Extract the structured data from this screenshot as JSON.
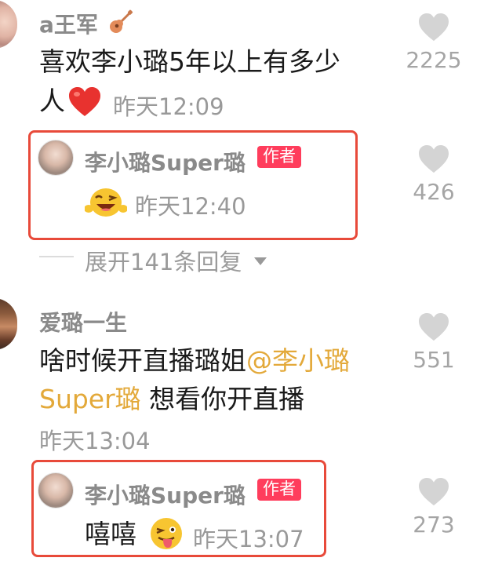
{
  "comments": [
    {
      "username": "a王军",
      "username_icon": "guitar-icon",
      "text_line1": "喜欢李小璐5年以上有多少",
      "text_line2": "人",
      "text_emoji": "red-heart-icon",
      "time": "昨天12:09",
      "likes": "2225",
      "reply": {
        "username": "李小璐Super璐",
        "badge": "作者",
        "emoji": "laughing-winking-emoji",
        "time": "昨天12:40",
        "likes": "426"
      },
      "expand_label": "展开141条回复"
    },
    {
      "username": "爱璐一生",
      "text_line1": "啥时候开直播璐姐",
      "mention_line1": "@李小璐",
      "mention_line2": "Super璐",
      "text_line2": " 想看你开直播",
      "time": "昨天13:04",
      "likes": "551",
      "reply": {
        "username": "李小璐Super璐",
        "badge": "作者",
        "text": "嘻嘻",
        "emoji": "tongue-winking-emoji",
        "time": "昨天13:07",
        "likes": "273"
      }
    }
  ],
  "colors": {
    "highlight_border": "#e84a3a",
    "author_badge": "#ff3d5c",
    "mention": "#e3a93a",
    "like_icon": "#d0d0d0"
  }
}
